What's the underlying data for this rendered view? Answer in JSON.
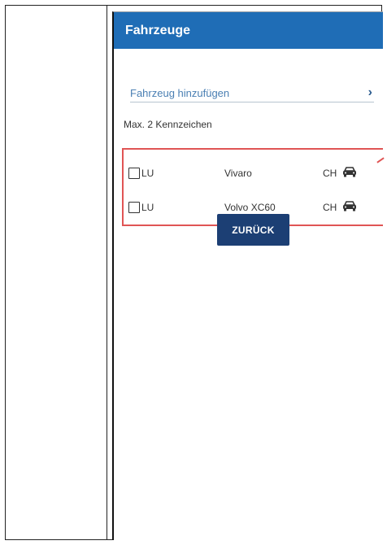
{
  "header": {
    "title": "Fahrzeuge"
  },
  "add_vehicle": {
    "label": "Fahrzeug hinzufügen",
    "icon": "chevron-right-icon"
  },
  "limit_text": "Max. 2 Kennzeichen",
  "vehicles": [
    {
      "plate": "LU",
      "model": "Vivaro",
      "country": "CH",
      "icon": "car-icon",
      "checked": false
    },
    {
      "plate": "LU",
      "model": "Volvo XC60",
      "country": "CH",
      "icon": "car-icon",
      "checked": false
    }
  ],
  "back_button": {
    "label": "ZURÜCK"
  },
  "colors": {
    "app_bar": "#1f6db6",
    "button": "#1c3f74",
    "highlight": "#e05555",
    "link": "#4a7fb3"
  }
}
